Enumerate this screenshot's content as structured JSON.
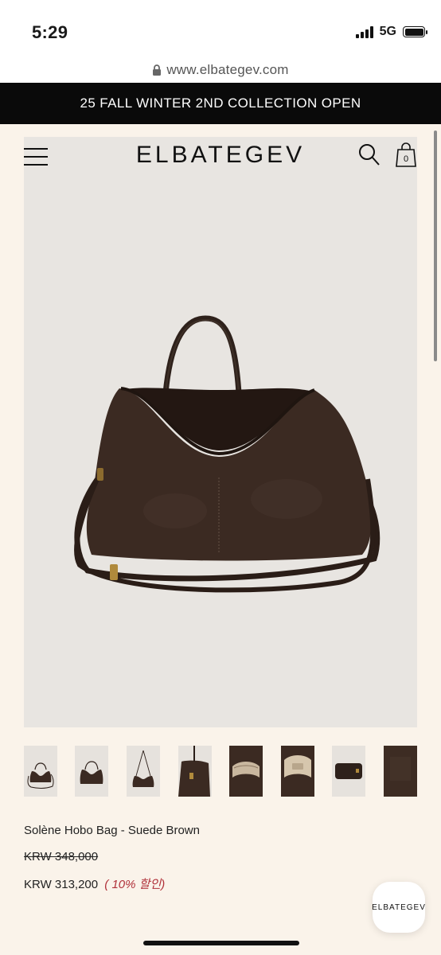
{
  "status_bar": {
    "time": "5:29",
    "network": "5G"
  },
  "browser": {
    "url": "www.elbategev.com"
  },
  "announcement": {
    "text": "25 FALL WINTER 2ND COLLECTION OPEN"
  },
  "header": {
    "logo": "ELBATEGEV",
    "cart_count": "0"
  },
  "icons": {
    "menu": "hamburger-icon",
    "search": "search-icon",
    "cart": "shopping-bag-icon",
    "lock": "lock-icon"
  },
  "product": {
    "name": "Solène Hobo Bag - Suede Brown",
    "original_price": "KRW 348,000",
    "sale_price": "KRW 313,200",
    "discount": "( 10% 할인)",
    "thumbnail_count": 8
  },
  "floating_button": {
    "label": "ELBATEGEV"
  },
  "colors": {
    "background": "#faf3ea",
    "announcement_bg": "#0a0a0a",
    "discount": "#b0313a",
    "bag": "#3a2a22"
  }
}
